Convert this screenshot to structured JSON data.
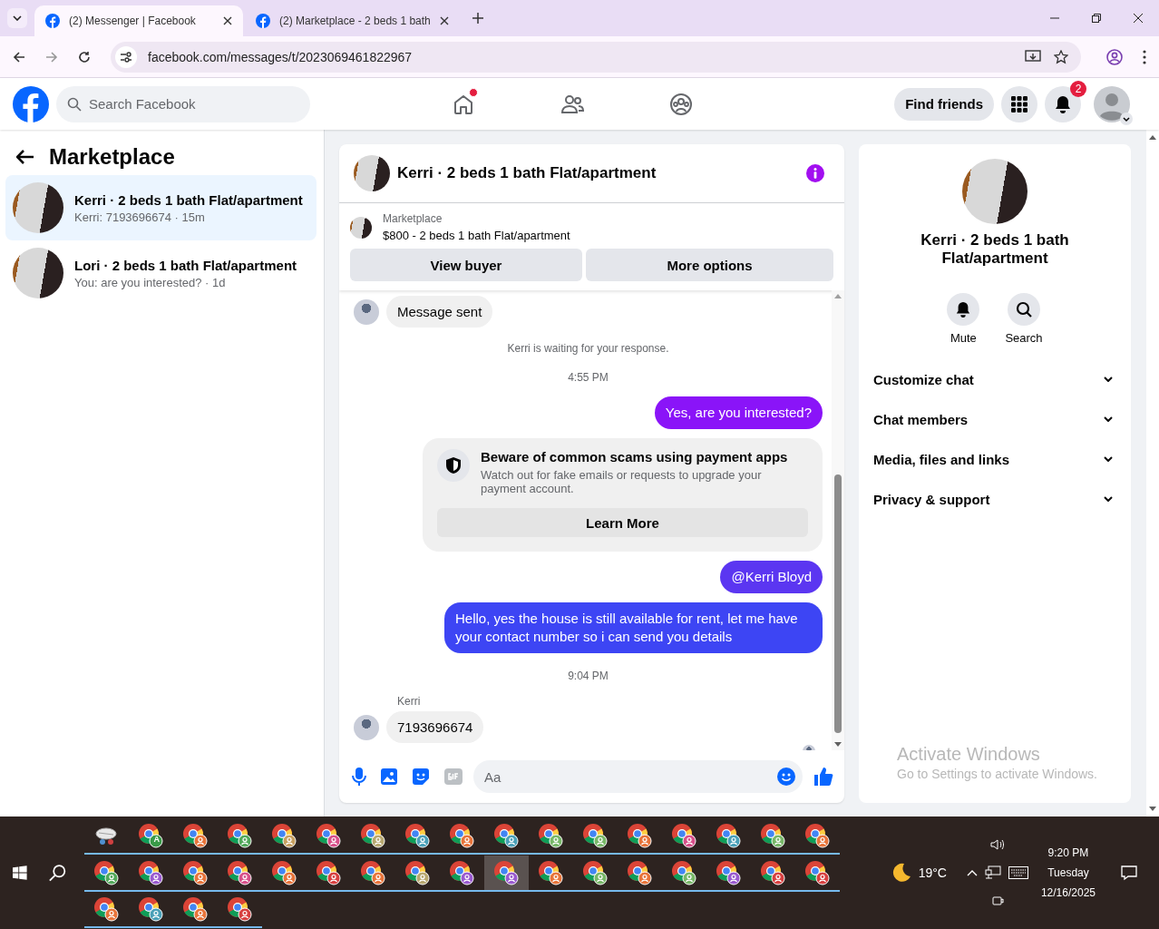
{
  "browser": {
    "tabs": [
      {
        "title": "(2) Messenger | Facebook",
        "selected": true
      },
      {
        "title": "(2) Marketplace - 2 beds 1 bath",
        "selected": false
      }
    ],
    "url": "facebook.com/messages/t/2023069461822967"
  },
  "topnav": {
    "search": {
      "placeholder": "Search Facebook"
    },
    "nav": [
      {
        "kind": "home",
        "notification_dot": true
      },
      {
        "kind": "friends",
        "notification_dot": false
      },
      {
        "kind": "groups",
        "notification_dot": false
      }
    ],
    "find_friends": "Find friends",
    "notifications_badge": "2"
  },
  "sidebar": {
    "title": "Marketplace",
    "conversations": [
      {
        "title": "Kerri · 2 beds 1 bath Flat/apartment",
        "preview": "Kerri: 7193696674 · 15m",
        "selected": true
      },
      {
        "title": "Lori · 2 beds 1 bath Flat/apartment",
        "preview": "You: are you interested? · 1d",
        "selected": false
      }
    ]
  },
  "chat": {
    "title": "Kerri · 2 beds 1 bath Flat/apartment",
    "listing": {
      "label": "Marketplace",
      "title": "$800 - 2 beds 1 bath Flat/apartment"
    },
    "actions": [
      "View buyer",
      "More options"
    ],
    "messages": [
      {
        "kind": "incoming",
        "text": "Message sent"
      },
      {
        "kind": "notice",
        "text": "Kerri is waiting for your response."
      },
      {
        "kind": "time",
        "text": "4:55 PM"
      },
      {
        "kind": "outgoing",
        "text": "Yes, are you interested?",
        "color": "#8a14f8"
      },
      {
        "kind": "warning",
        "title": "Beware of common scams using payment apps",
        "text": "Watch out for fake emails or requests to upgrade your payment account.",
        "button": "Learn More"
      },
      {
        "kind": "outgoing",
        "text": "@Kerri Bloyd",
        "color": "#5b36f1"
      },
      {
        "kind": "outgoing",
        "text": "Hello, yes the house is still available for rent, let me have your contact number so i can send you details",
        "color": "#3d45f4"
      },
      {
        "kind": "time",
        "text": "9:04 PM"
      },
      {
        "kind": "incoming",
        "sender": "Kerri",
        "text": "7193696674"
      }
    ],
    "composer": {
      "placeholder": "Aa"
    }
  },
  "details": {
    "title": "Kerri · 2 beds 1 bath Flat/apartment",
    "actions": [
      {
        "kind": "mute",
        "label": "Mute"
      },
      {
        "kind": "search",
        "label": "Search"
      }
    ],
    "sections": [
      "Customize chat",
      "Chat members",
      "Media, files and links",
      "Privacy & support"
    ]
  },
  "activation": {
    "title": "Activate Windows",
    "subtitle": "Go to Settings to activate Windows."
  },
  "taskbar": {
    "apps": [
      {
        "kind": "app",
        "color": "#d04040",
        "selected": false
      },
      {
        "kind": "browser",
        "color": "#3a9a48",
        "badge_text": "A",
        "selected": false
      },
      {
        "kind": "browser",
        "color": "#e8743a",
        "selected": false
      },
      {
        "kind": "browser",
        "color": "#52a85a",
        "selected": false
      },
      {
        "kind": "browser",
        "color": "#c8a060",
        "selected": false
      },
      {
        "kind": "browser",
        "color": "#d8508a",
        "selected": false
      },
      {
        "kind": "browser",
        "color": "#b8a870",
        "selected": false
      },
      {
        "kind": "browser",
        "color": "#4aa0b8",
        "selected": false
      },
      {
        "kind": "browser",
        "color": "#e8743a",
        "selected": false
      },
      {
        "kind": "browser",
        "color": "#4aa0b8",
        "selected": false
      },
      {
        "kind": "browser",
        "color": "#78b868",
        "selected": false
      },
      {
        "kind": "browser",
        "color": "#78b868",
        "selected": false
      },
      {
        "kind": "browser",
        "color": "#e8743a",
        "selected": false
      },
      {
        "kind": "browser",
        "color": "#d8508a",
        "selected": false
      },
      {
        "kind": "browser",
        "color": "#4aa0b8",
        "selected": false
      },
      {
        "kind": "browser",
        "color": "#78b868",
        "selected": false
      },
      {
        "kind": "browser",
        "color": "#e8743a",
        "selected": false
      },
      {
        "kind": "browser",
        "color": "#52a85a",
        "selected": false
      },
      {
        "kind": "browser",
        "color": "#9a5ad0",
        "selected": false
      },
      {
        "kind": "browser",
        "color": "#e8743a",
        "selected": false
      },
      {
        "kind": "browser",
        "color": "#d8508a",
        "selected": false
      },
      {
        "kind": "browser",
        "color": "#e8743a",
        "selected": false
      },
      {
        "kind": "browser",
        "color": "#d84040",
        "selected": false
      },
      {
        "kind": "browser",
        "color": "#e8743a",
        "selected": false
      },
      {
        "kind": "browser",
        "color": "#b8a870",
        "selected": false
      },
      {
        "kind": "browser",
        "color": "#9a5ad0",
        "selected": false
      },
      {
        "kind": "browser",
        "color": "#9a5ad0",
        "selected": true
      },
      {
        "kind": "browser",
        "color": "#e8743a",
        "selected": false
      },
      {
        "kind": "browser",
        "color": "#78b868",
        "selected": false
      },
      {
        "kind": "browser",
        "color": "#e8743a",
        "selected": false
      },
      {
        "kind": "browser",
        "color": "#78b868",
        "selected": false
      },
      {
        "kind": "browser",
        "color": "#9a5ad0",
        "selected": false
      },
      {
        "kind": "browser",
        "color": "#d84040",
        "selected": false
      },
      {
        "kind": "browser",
        "color": "#d84040",
        "selected": false
      },
      {
        "kind": "browser",
        "color": "#e8743a",
        "selected": false
      },
      {
        "kind": "browser",
        "color": "#4aa0b8",
        "selected": false
      },
      {
        "kind": "browser",
        "color": "#e8743a",
        "selected": false
      },
      {
        "kind": "browser",
        "color": "#d84040",
        "selected": false
      }
    ],
    "weather": "19°C",
    "clock": {
      "time": "9:20 PM",
      "day": "Tuesday",
      "date": "12/16/2025"
    }
  }
}
